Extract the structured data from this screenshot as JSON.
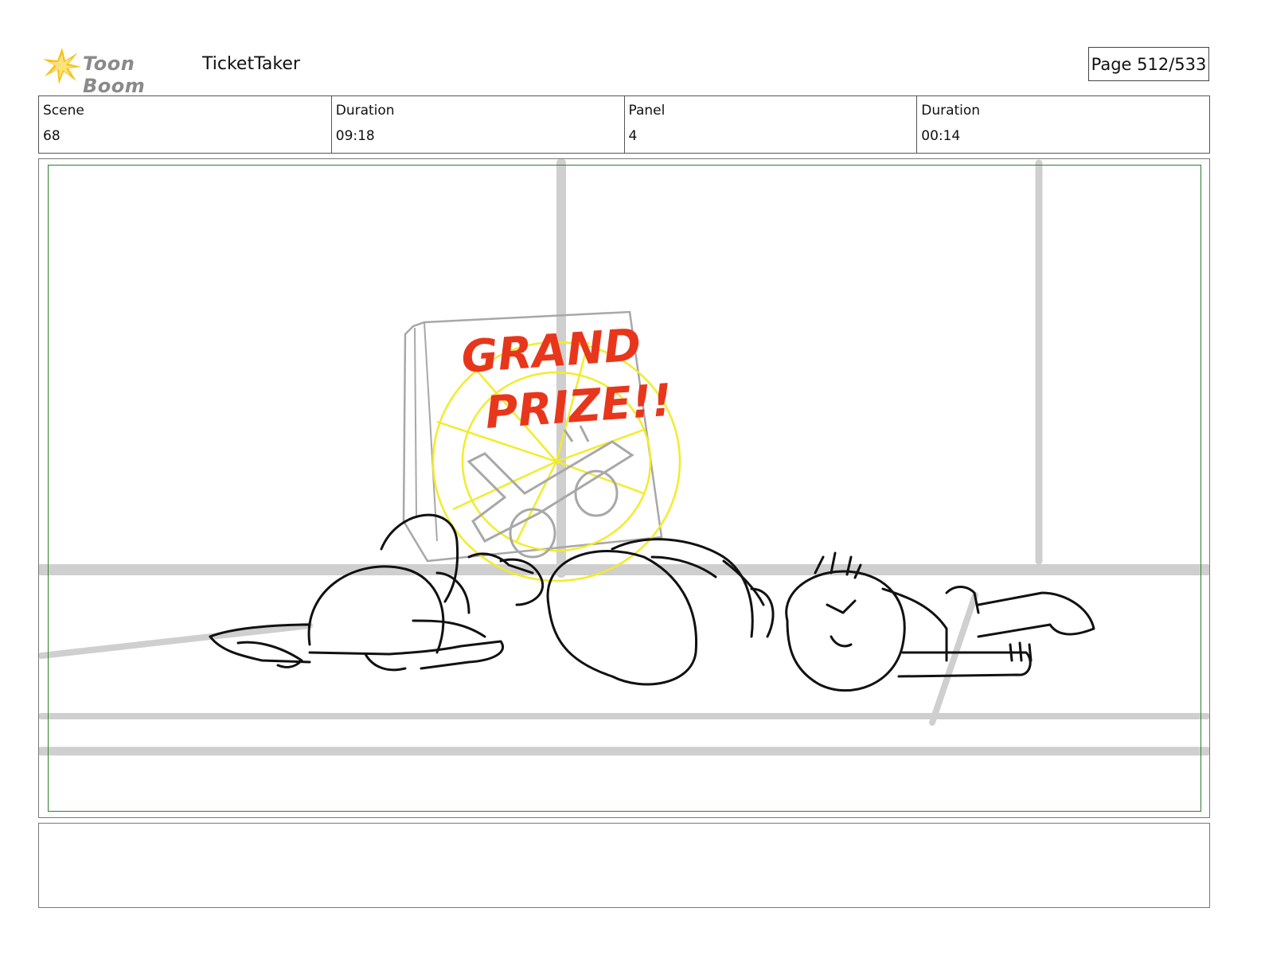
{
  "header": {
    "logo_text": "Toon Boom",
    "project_title": "TicketTaker",
    "page_label": "Page 512/533"
  },
  "info": {
    "scene_label": "Scene",
    "scene_value": "68",
    "scene_duration_label": "Duration",
    "scene_duration_value": "09:18",
    "panel_label": "Panel",
    "panel_value": "4",
    "panel_duration_label": "Duration",
    "panel_duration_value": "00:14"
  },
  "panel": {
    "sign_line1": "GRAND",
    "sign_line2": "PRIZE!!"
  },
  "colors": {
    "safe_frame": "#2f7d2f",
    "sign_text": "#e8361c",
    "sign_burst": "#f2ec2a",
    "background_lines": "#cfcfcf"
  }
}
